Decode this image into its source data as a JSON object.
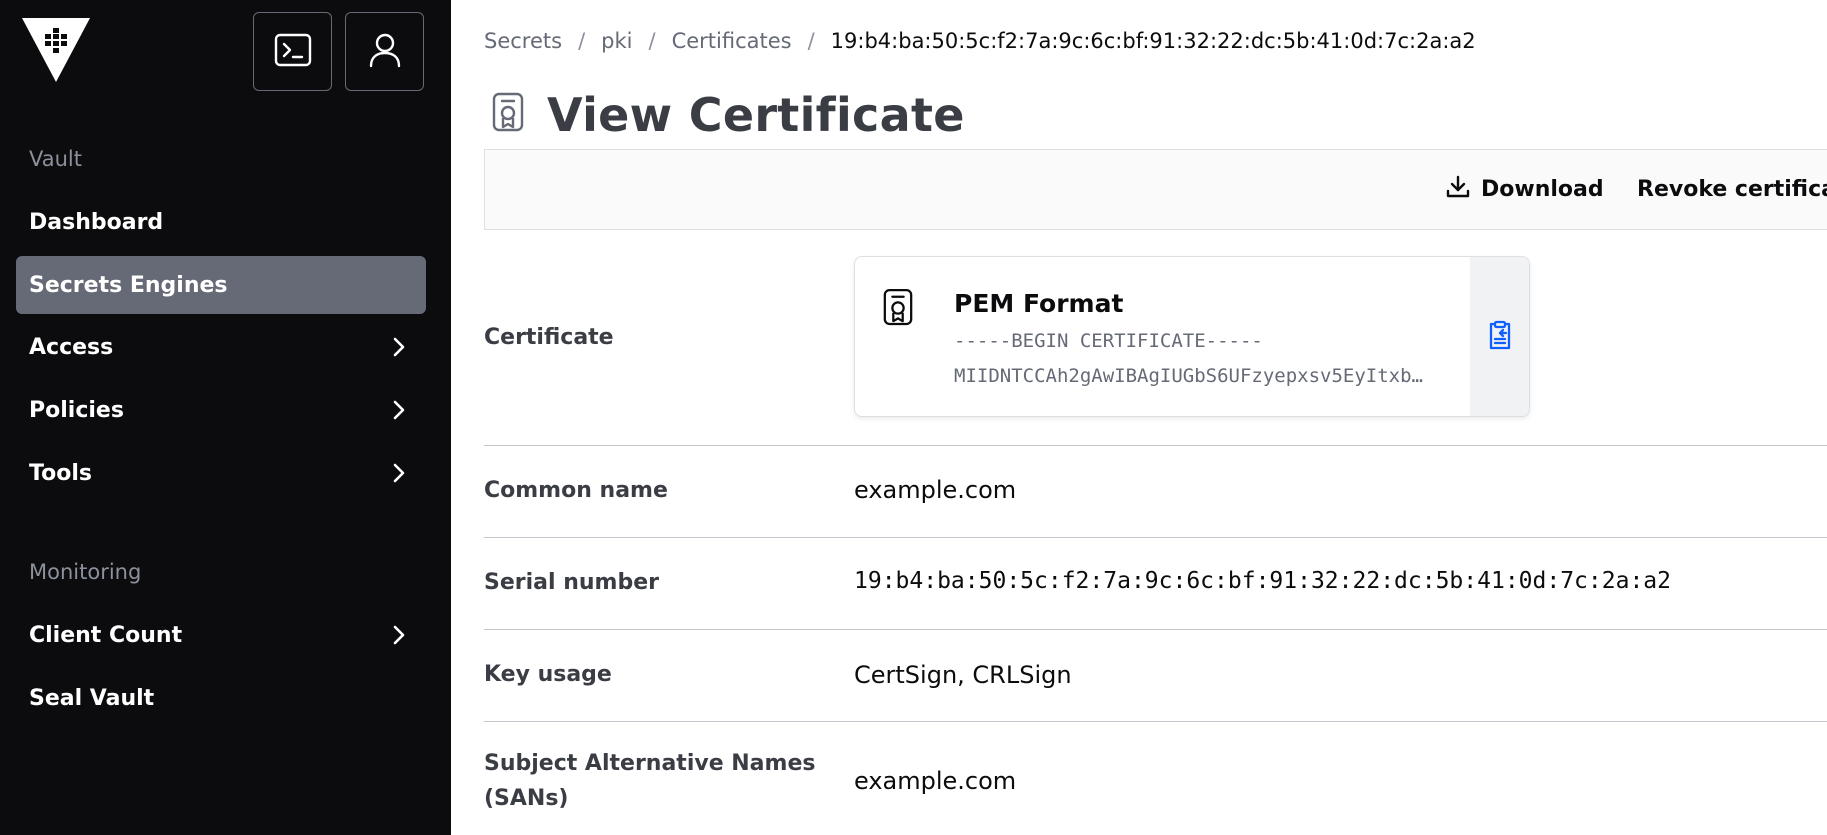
{
  "sidebar": {
    "logo_icon": "vault-logo-icon",
    "console_icon": "terminal-icon",
    "user_icon": "user-icon",
    "sections": {
      "vault": "Vault",
      "monitoring": "Monitoring"
    },
    "items": [
      {
        "label": "Dashboard",
        "has_chevron": false,
        "active": false
      },
      {
        "label": "Secrets Engines",
        "has_chevron": false,
        "active": true
      },
      {
        "label": "Access",
        "has_chevron": true,
        "active": false
      },
      {
        "label": "Policies",
        "has_chevron": true,
        "active": false
      },
      {
        "label": "Tools",
        "has_chevron": true,
        "active": false
      },
      {
        "label": "Client Count",
        "has_chevron": true,
        "active": false
      },
      {
        "label": "Seal Vault",
        "has_chevron": false,
        "active": false
      }
    ]
  },
  "breadcrumb": {
    "items": [
      "Secrets",
      "pki",
      "Certificates"
    ],
    "separator": "/",
    "current": "19:b4:ba:50:5c:f2:7a:9c:6c:bf:91:32:22:dc:5b:41:0d:7c:2a:a2"
  },
  "page": {
    "title": "View Certificate",
    "title_icon": "certificate-icon"
  },
  "toolbar": {
    "download_label": "Download",
    "download_icon": "download-icon",
    "revoke_label": "Revoke certificate"
  },
  "details": {
    "certificate": {
      "label": "Certificate",
      "card_title": "PEM Format",
      "card_icon": "certificate-icon",
      "line1": "-----BEGIN CERTIFICATE-----",
      "line2": "MIIDNTCCAh2gAwIBAgIUGbS6UFzyepxsv5EyItxb…",
      "copy_icon": "clipboard-copy-icon"
    },
    "common_name": {
      "label": "Common name",
      "value": "example.com"
    },
    "serial_number": {
      "label": "Serial number",
      "value": "19:b4:ba:50:5c:f2:7a:9c:6c:bf:91:32:22:dc:5b:41:0d:7c:2a:a2"
    },
    "key_usage": {
      "label": "Key usage",
      "value": "CertSign, CRLSign"
    },
    "sans": {
      "label_line1": "Subject Alternative Names",
      "label_line2": "(SANs)",
      "value": "example.com"
    }
  },
  "colors": {
    "sidebar_bg": "#0c0c0e",
    "active_item_bg": "#656a76",
    "copy_icon": "#1060ff"
  }
}
